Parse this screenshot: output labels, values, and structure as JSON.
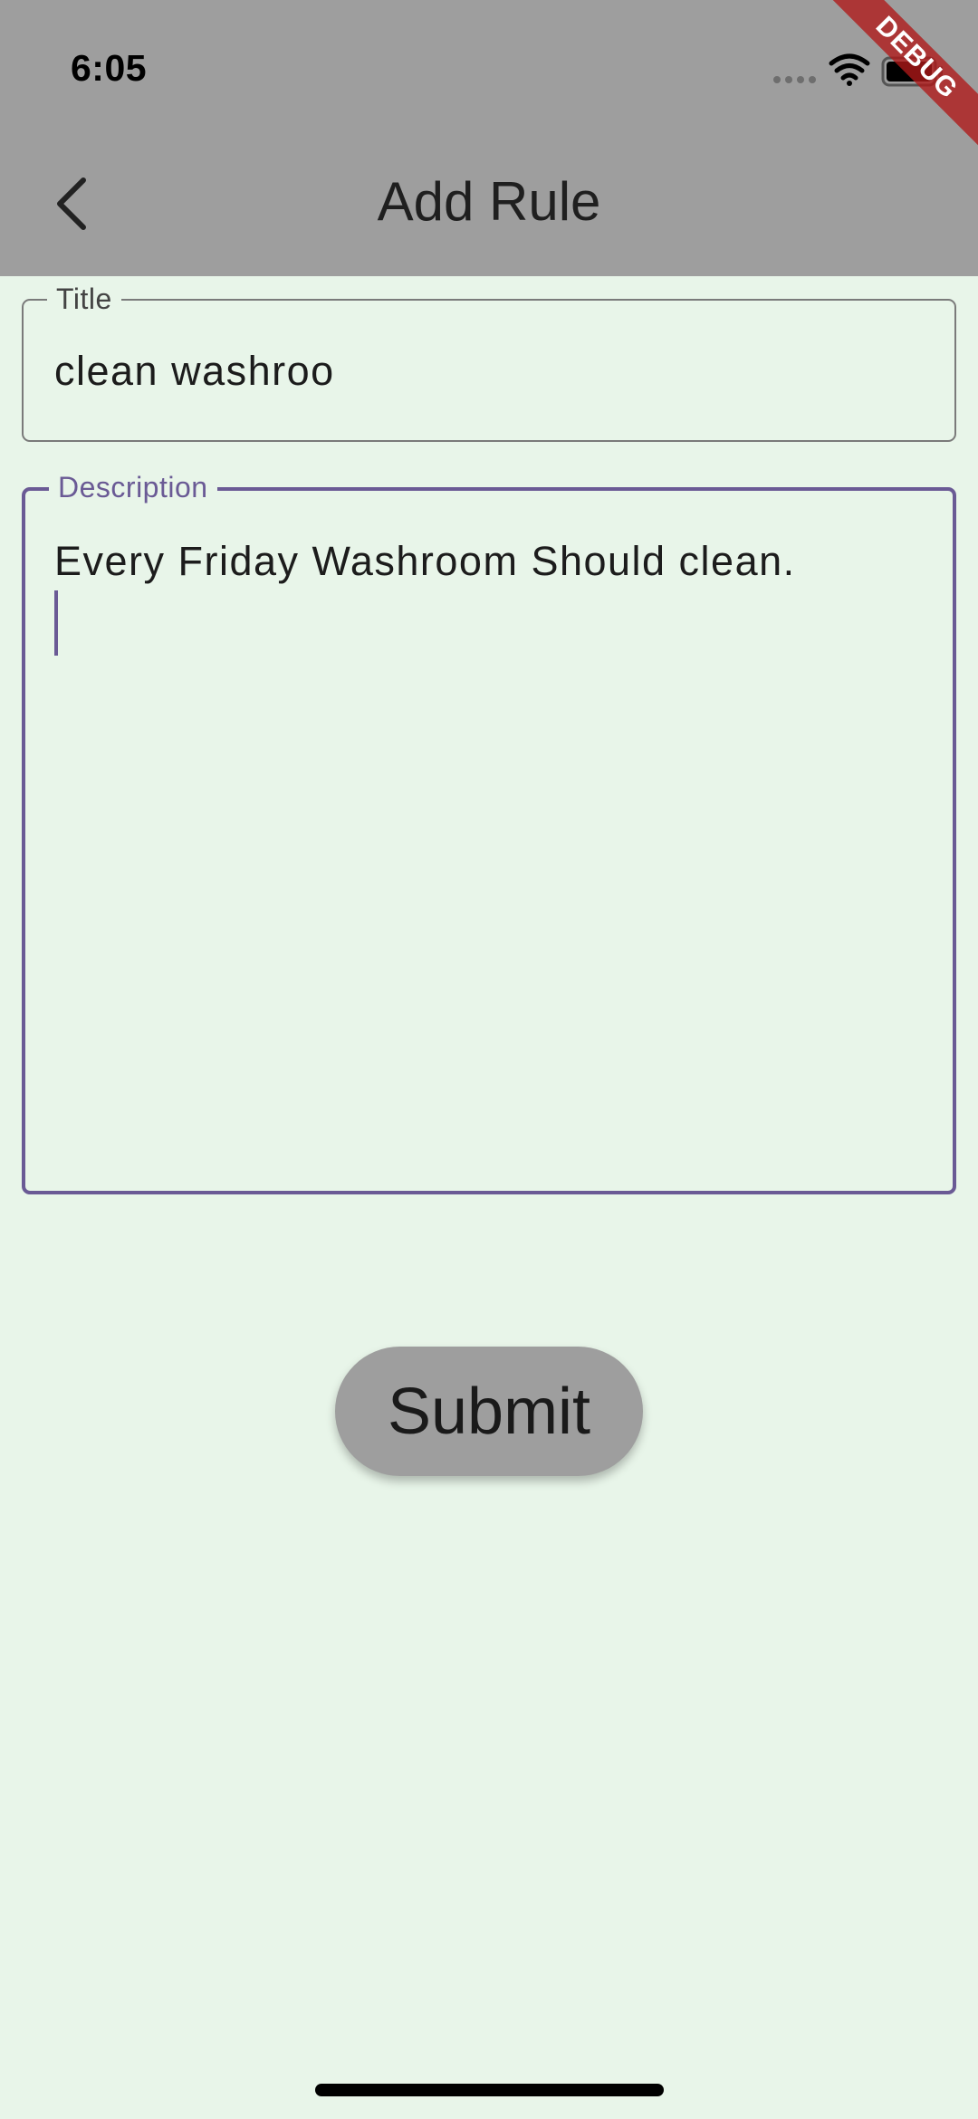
{
  "status_bar": {
    "time": "6:05",
    "icons": [
      "signal-dots-icon",
      "wifi-icon",
      "battery-icon"
    ]
  },
  "debug_banner": {
    "label": "DEBUG"
  },
  "app_bar": {
    "title": "Add Rule",
    "back_icon": "chevron-left-icon"
  },
  "form": {
    "title_field": {
      "label": "Title",
      "value": "clean washroo"
    },
    "description_field": {
      "label": "Description",
      "value": "Every Friday Washroom Should clean.",
      "focused": true
    },
    "submit_label": "Submit"
  },
  "colors": {
    "background": "#e8f5e9",
    "app_bar": "#9e9e9e",
    "focus_accent": "#6a5a95",
    "button": "#9e9e9e"
  }
}
